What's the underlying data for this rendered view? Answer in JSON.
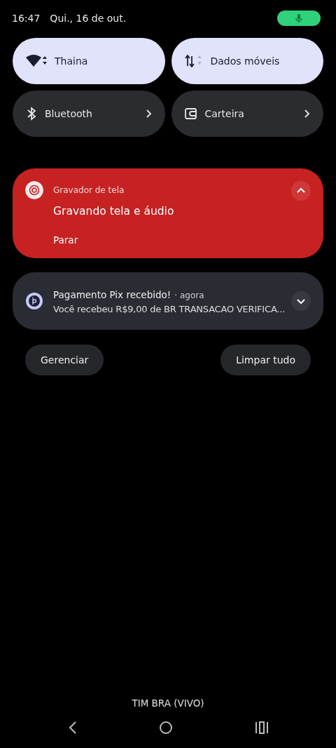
{
  "status_bar": {
    "time": "16:47",
    "date": "Qui., 16 de out.",
    "mic_active": true
  },
  "tiles": [
    {
      "label": "Thaina",
      "kind": "wifi",
      "on": true
    },
    {
      "label": "Dados móveis",
      "kind": "data",
      "on": true
    },
    {
      "label": "Bluetooth",
      "kind": "bluetooth",
      "on": false
    },
    {
      "label": "Carteira",
      "kind": "wallet",
      "on": false
    }
  ],
  "notifications": [
    {
      "kind": "recording",
      "app": "Gravador de tela",
      "title": "Gravando tela e áudio",
      "action": "Parar",
      "expanded": true
    },
    {
      "kind": "payment",
      "title": "Pagamento Pix recebido!",
      "time": "· agora",
      "text": "Você recebeu R$9,00 de BR TRANSACAO VERIFICA...",
      "expanded": false
    }
  ],
  "buttons": [
    "Gerenciar",
    "Limpar tudo"
  ],
  "carrier": "TIM BRA (VIVO)"
}
